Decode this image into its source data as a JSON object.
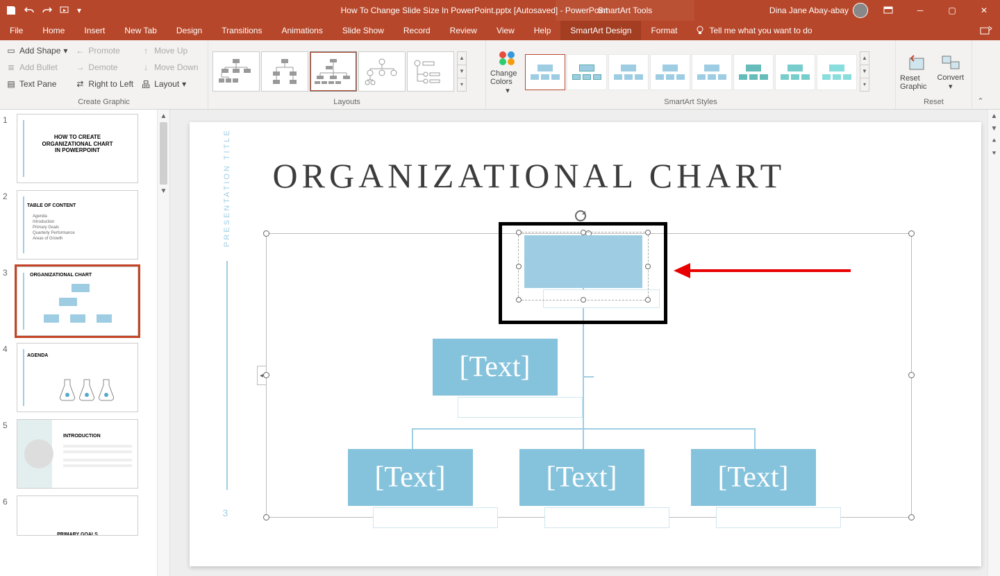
{
  "title_bar": {
    "doc_title": "How To Change Slide Size In PowerPoint.pptx [Autosaved]  -  PowerPoint",
    "contextual_tab": "SmartArt Tools",
    "user_name": "Dina Jane Abay-abay"
  },
  "tabs": {
    "file": "File",
    "home": "Home",
    "insert": "Insert",
    "new_tab": "New Tab",
    "design": "Design",
    "transitions": "Transitions",
    "animations": "Animations",
    "slide_show": "Slide Show",
    "record": "Record",
    "review": "Review",
    "view": "View",
    "help": "Help",
    "smartart_design": "SmartArt Design",
    "format": "Format",
    "tell_me": "Tell me what you want to do"
  },
  "ribbon": {
    "create_graphic": {
      "label": "Create Graphic",
      "add_shape": "Add Shape",
      "add_bullet": "Add Bullet",
      "text_pane": "Text Pane",
      "promote": "Promote",
      "demote": "Demote",
      "right_to_left": "Right to Left",
      "move_up": "Move Up",
      "move_down": "Move Down",
      "layout": "Layout"
    },
    "layouts": {
      "label": "Layouts"
    },
    "styles": {
      "label": "SmartArt Styles",
      "change_colors": "Change Colors"
    },
    "reset": {
      "label": "Reset",
      "reset_graphic": "Reset Graphic",
      "convert": "Convert"
    }
  },
  "thumbnails": [
    {
      "num": "1",
      "t1": "HOW TO CREATE",
      "t2": "ORGANIZATIONAL CHART",
      "t3": "IN POWERPOINT"
    },
    {
      "num": "2",
      "head": "TABLE OF CONTENT",
      "i1": "Agenda",
      "i2": "Introduction",
      "i3": "Primary Goals",
      "i4": "Quarterly Performance",
      "i5": "Areas of Growth"
    },
    {
      "num": "3",
      "title": "ORGANIZATIONAL CHART"
    },
    {
      "num": "4",
      "title": "AGENDA"
    },
    {
      "num": "5",
      "title": "INTRODUCTION"
    },
    {
      "num": "6",
      "title": "PRIMARY GOALS"
    }
  ],
  "slide": {
    "side_title": "PRESENTATION TITLE",
    "side_num": "3",
    "title": "ORGANIZATIONAL CHART",
    "placeholder": "[Text]"
  }
}
